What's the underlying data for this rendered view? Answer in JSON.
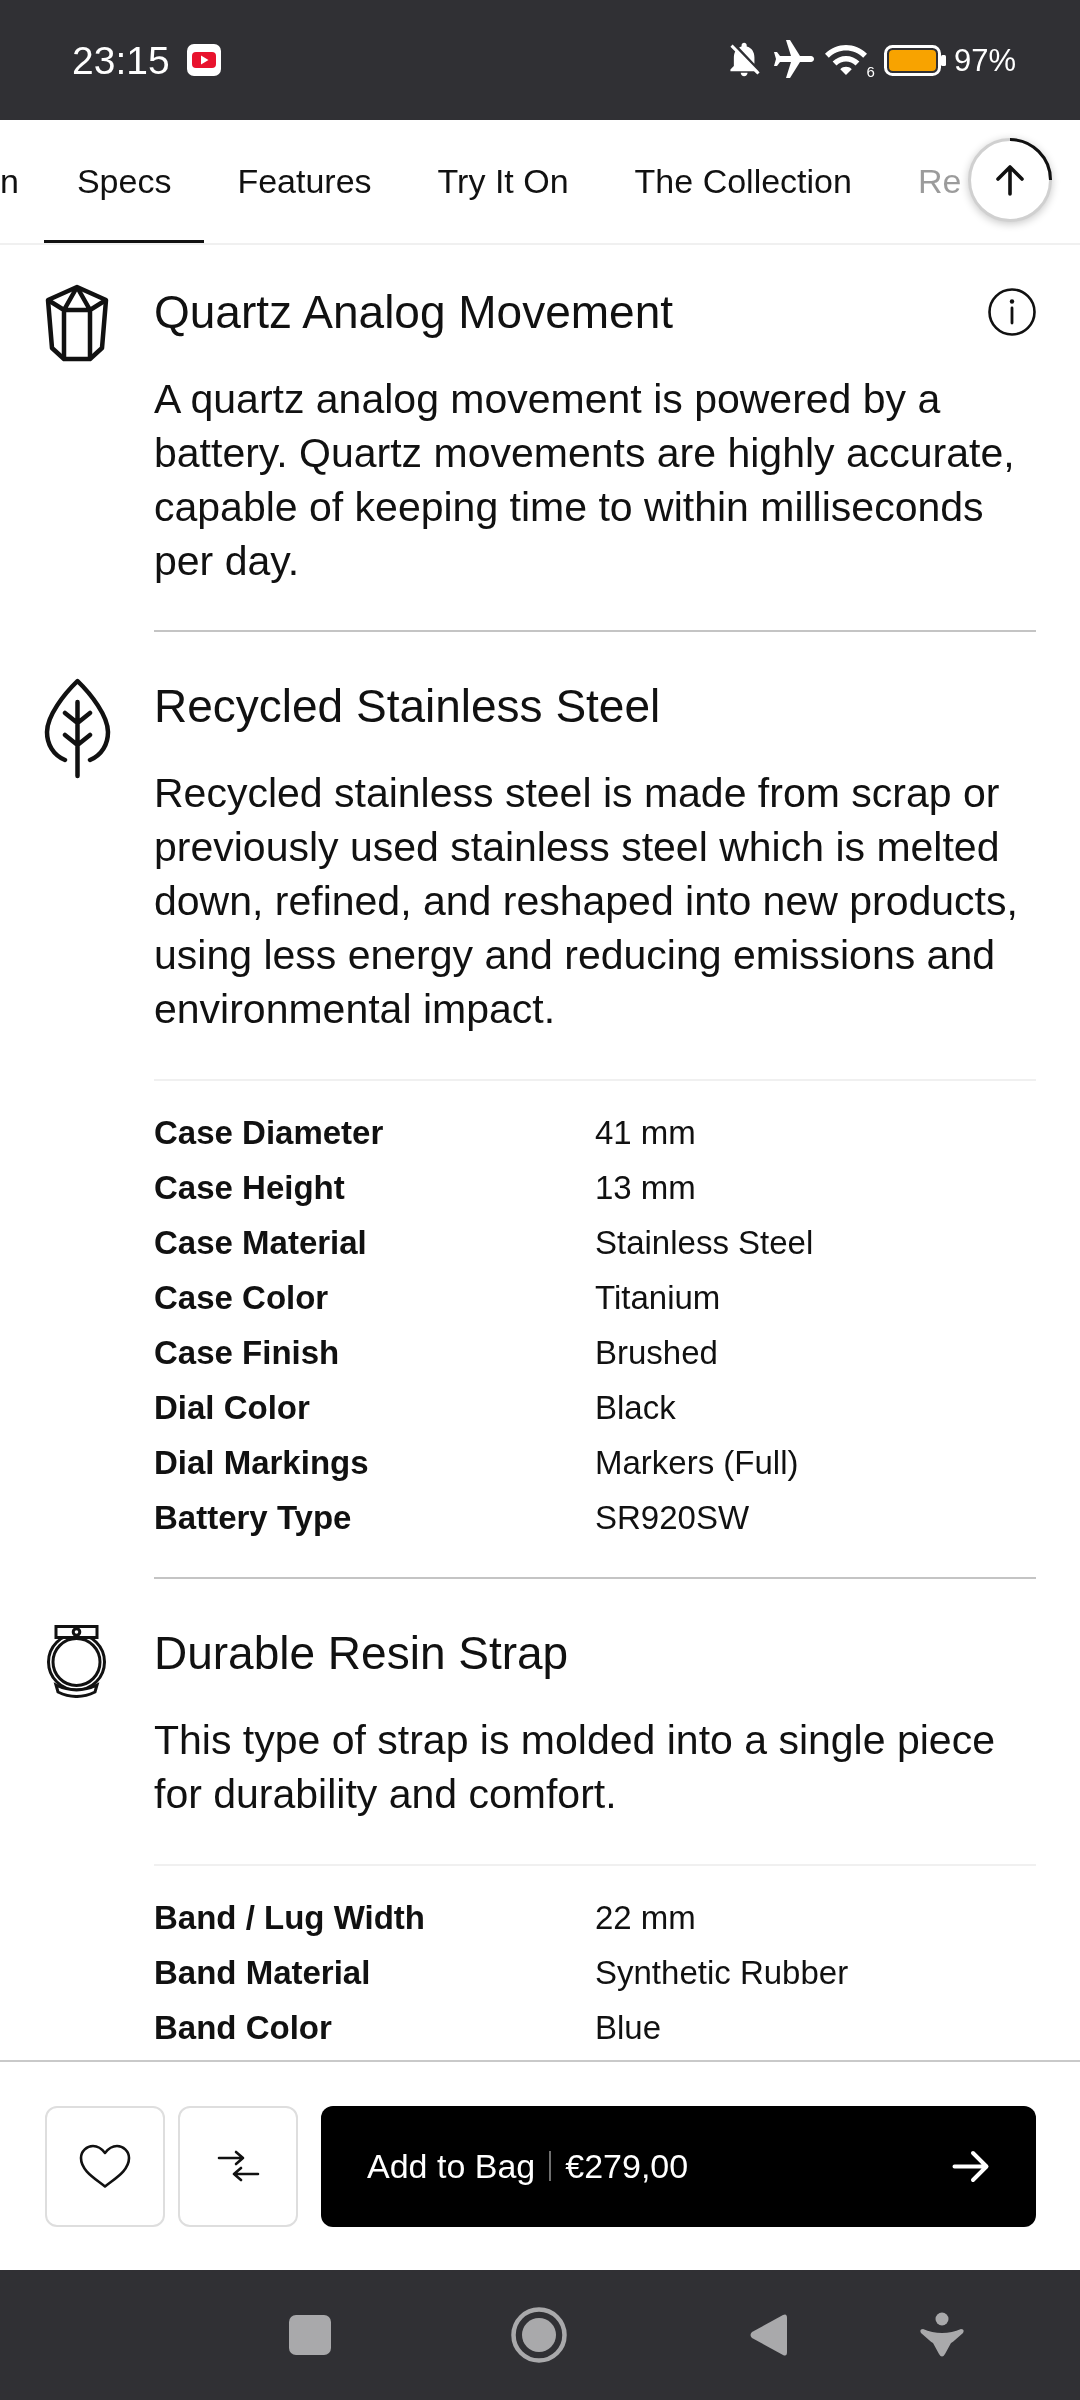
{
  "status_bar": {
    "time": "23:15",
    "wifi_badge": "6",
    "battery": "97%"
  },
  "tabs": [
    {
      "label": "n",
      "selected": false
    },
    {
      "label": "Specs",
      "selected": true
    },
    {
      "label": "Features",
      "selected": false
    },
    {
      "label": "Try It On",
      "selected": false
    },
    {
      "label": "The Collection",
      "selected": false
    },
    {
      "label": "Re",
      "selected": false
    }
  ],
  "sections": [
    {
      "title": "Quartz Analog Movement",
      "info": true,
      "description": "A quartz analog movement is powered by a battery. Quartz movements are highly accurate, capable of keeping time to within milliseconds per day."
    },
    {
      "title": "Recycled Stainless Steel",
      "description": "Recycled stainless steel is made from scrap or previously used stainless steel which is melted down, refined, and reshaped into new products, using less energy and reducing emissions and environmental impact.",
      "specs": [
        {
          "label": "Case Diameter",
          "value": "41 mm"
        },
        {
          "label": "Case Height",
          "value": "13 mm"
        },
        {
          "label": "Case Material",
          "value": "Stainless Steel"
        },
        {
          "label": "Case Color",
          "value": "Titanium"
        },
        {
          "label": "Case Finish",
          "value": "Brushed"
        },
        {
          "label": "Dial Color",
          "value": "Black"
        },
        {
          "label": "Dial Markings",
          "value": "Markers (Full)"
        },
        {
          "label": "Battery Type",
          "value": "SR920SW"
        }
      ]
    },
    {
      "title": "Durable Resin Strap",
      "description": "This type of strap is molded into a single piece for durability and comfort.",
      "specs": [
        {
          "label": "Band / Lug Width",
          "value": "22 mm"
        },
        {
          "label": "Band Material",
          "value": "Synthetic Rubber"
        },
        {
          "label": "Band Color",
          "value": "Blue"
        }
      ]
    }
  ],
  "purchase_bar": {
    "button": "Add to Bag",
    "price": "€279,00"
  }
}
